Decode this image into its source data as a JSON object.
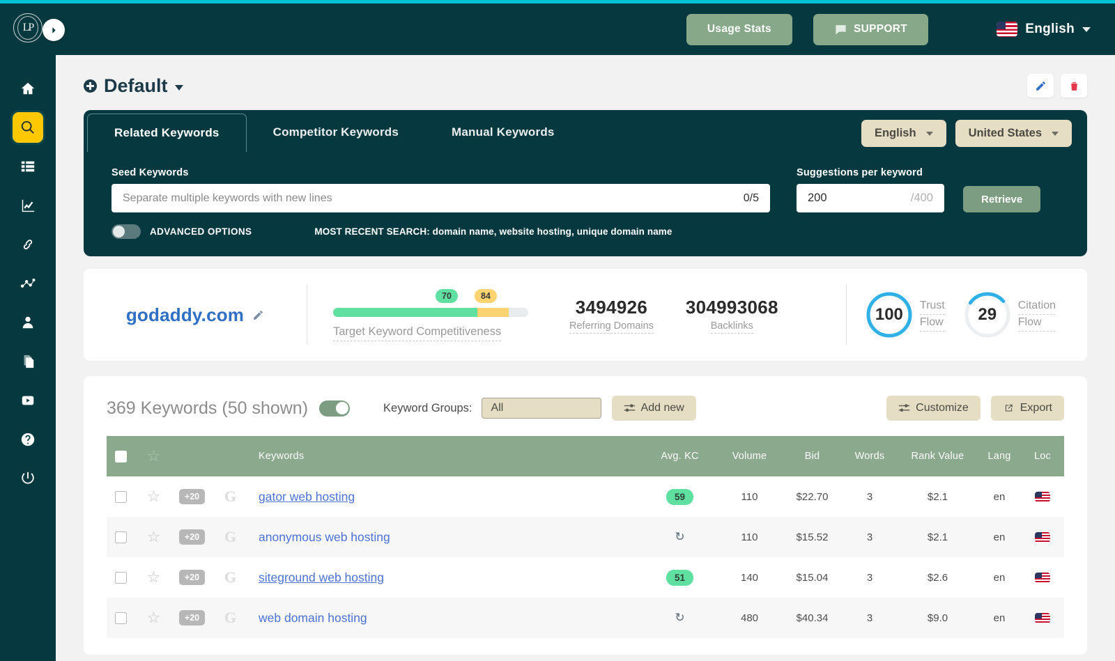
{
  "brand": {
    "logo_text": "LP"
  },
  "header": {
    "usage_stats_label": "Usage Stats",
    "support_label": "SUPPORT",
    "language_label": "English"
  },
  "sidebar": {
    "items": [
      {
        "name": "home-icon",
        "label": "Home"
      },
      {
        "name": "search-icon",
        "label": "Keyword Research",
        "active": true
      },
      {
        "name": "list-icon",
        "label": "Lists"
      },
      {
        "name": "chart-line-icon",
        "label": "Rank Tracking"
      },
      {
        "name": "link-icon",
        "label": "Backlinks"
      },
      {
        "name": "network-icon",
        "label": "Network"
      },
      {
        "name": "user-icon",
        "label": "Account"
      },
      {
        "name": "pages-icon",
        "label": "Pages"
      },
      {
        "name": "youtube-icon",
        "label": "YouTube"
      },
      {
        "name": "help-icon",
        "label": "Help"
      },
      {
        "name": "power-icon",
        "label": "Logout"
      }
    ]
  },
  "page": {
    "project_title": "Default"
  },
  "search_panel": {
    "tabs": [
      {
        "label": "Related Keywords",
        "active": true
      },
      {
        "label": "Competitor Keywords",
        "active": false
      },
      {
        "label": "Manual Keywords",
        "active": false
      }
    ],
    "language_select": "English",
    "country_select": "United States",
    "seed_label": "Seed Keywords",
    "seed_placeholder": "Separate multiple keywords with new lines",
    "seed_value": "",
    "seed_count": "0/5",
    "suggestions_label": "Suggestions per keyword",
    "suggestions_value": "200",
    "suggestions_max": "/400",
    "retrieve_label": "Retrieve",
    "advanced_options_label": "ADVANCED OPTIONS",
    "advanced_options_on": false,
    "recent_search": "MOST RECENT SEARCH: domain name, website hosting, unique domain name"
  },
  "metrics": {
    "domain": "godaddy.com",
    "competitiveness_label": "Target Keyword Competitiveness",
    "competitiveness_green": 70,
    "competitiveness_yellow": 84,
    "bar_green_pct": 74,
    "bar_yellow_pct": 16,
    "referring_domains_value": "3494926",
    "referring_domains_label": "Referring Domains",
    "backlinks_value": "304993068",
    "backlinks_label": "Backlinks",
    "trust_flow_value": "100",
    "trust_flow_label_1": "Trust",
    "trust_flow_label_2": "Flow",
    "trust_flow_pct": 100,
    "citation_flow_value": "29",
    "citation_flow_label_1": "Citation",
    "citation_flow_label_2": "Flow",
    "citation_flow_pct": 29,
    "accent_blue": "#31b0e8",
    "green": "#5fdfa0",
    "yellow": "#ffd370"
  },
  "keywords": {
    "count_label": "369 Keywords (50 shown)",
    "toggle_on": true,
    "groups_label": "Keyword Groups:",
    "groups_value": "All",
    "add_new_label": "Add new",
    "customize_label": "Customize",
    "export_label": "Export",
    "columns": [
      "",
      "",
      "Keywords",
      "Avg. KC",
      "Volume",
      "Bid",
      "Words",
      "Rank Value",
      "Lang",
      "Loc"
    ],
    "rows": [
      {
        "keyword": "gator web hosting",
        "underline": true,
        "badge": "+20",
        "kc": "59",
        "kc_type": "badge",
        "volume": "110",
        "bid": "$22.70",
        "words": "3",
        "rank_value": "$2.1",
        "lang": "en",
        "loc": "us-flag-icon"
      },
      {
        "keyword": "anonymous web hosting",
        "underline": false,
        "badge": "+20",
        "kc": "",
        "kc_type": "refresh",
        "volume": "110",
        "bid": "$15.52",
        "words": "3",
        "rank_value": "$2.1",
        "lang": "en",
        "loc": "us-flag-icon"
      },
      {
        "keyword": "siteground web hosting",
        "underline": true,
        "badge": "+20",
        "kc": "51",
        "kc_type": "badge",
        "volume": "140",
        "bid": "$15.04",
        "words": "3",
        "rank_value": "$2.6",
        "lang": "en",
        "loc": "us-flag-icon"
      },
      {
        "keyword": "web domain hosting",
        "underline": false,
        "badge": "+20",
        "kc": "",
        "kc_type": "refresh",
        "volume": "480",
        "bid": "$40.34",
        "words": "3",
        "rank_value": "$9.0",
        "lang": "en",
        "loc": "us-flag-icon"
      }
    ]
  }
}
